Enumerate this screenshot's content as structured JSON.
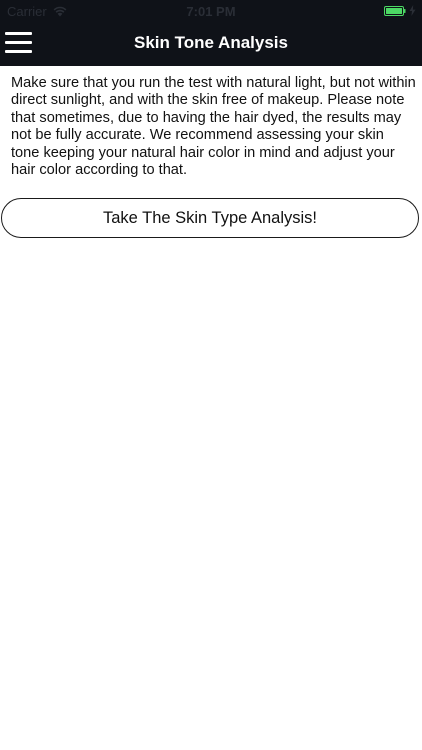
{
  "status_bar": {
    "carrier": "Carrier",
    "time": "7:01 PM",
    "wifi_icon": "wifi-icon",
    "battery_icon": "battery-icon",
    "charging_icon": "charging-bolt-icon",
    "battery_color": "#4cd964"
  },
  "nav": {
    "title": "Skin Tone Analysis",
    "menu_icon": "hamburger-menu-icon",
    "background": "#0f1218"
  },
  "content": {
    "intro_text": "Make sure that you run the test with natural light, but not within direct sunlight, and with the skin free of makeup. Please note that sometimes, due to having the hair dyed, the results may not be fully accurate. We recommend assessing your skin tone keeping your natural hair color in mind and adjust your hair color according to that.",
    "cta_label": "Take The Skin Type Analysis!"
  }
}
